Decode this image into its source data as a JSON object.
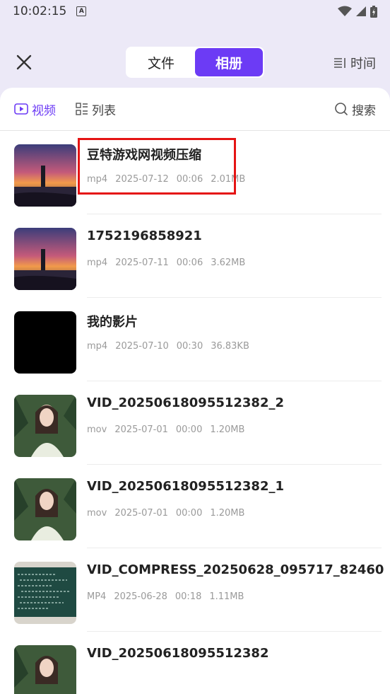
{
  "status_bar": {
    "time": "10:02:15",
    "a_label": "A"
  },
  "header": {
    "tabs": [
      {
        "label": "文件",
        "active": false
      },
      {
        "label": "相册",
        "active": true
      }
    ],
    "sort_label": "时间"
  },
  "toolbar": {
    "video_label": "视频",
    "list_label": "列表",
    "search_label": "搜索"
  },
  "files": [
    {
      "title": "豆特游戏网视频压缩",
      "type": "mp4",
      "date": "2025-07-12",
      "duration": "00:06",
      "size": "2.01MB",
      "thumb": "sunset"
    },
    {
      "title": "1752196858921",
      "type": "mp4",
      "date": "2025-07-11",
      "duration": "00:06",
      "size": "3.62MB",
      "thumb": "sunset"
    },
    {
      "title": "我的影片",
      "type": "mp4",
      "date": "2025-07-10",
      "duration": "00:30",
      "size": "36.83KB",
      "thumb": "black"
    },
    {
      "title": "VID_20250618095512382_2",
      "type": "mov",
      "date": "2025-07-01",
      "duration": "00:00",
      "size": "1.20MB",
      "thumb": "portrait"
    },
    {
      "title": "VID_20250618095512382_1",
      "type": "mov",
      "date": "2025-07-01",
      "duration": "00:00",
      "size": "1.20MB",
      "thumb": "portrait"
    },
    {
      "title": "VID_COMPRESS_20250628_095717_82460",
      "type": "MP4",
      "date": "2025-06-28",
      "duration": "00:18",
      "size": "1.11MB",
      "thumb": "chalkboard"
    },
    {
      "title": "VID_20250618095512382",
      "type": "",
      "date": "",
      "duration": "",
      "size": "",
      "thumb": "portrait"
    }
  ],
  "colors": {
    "accent": "#6c3bf5",
    "highlight": "#e51414",
    "background": "#ece9f7"
  }
}
